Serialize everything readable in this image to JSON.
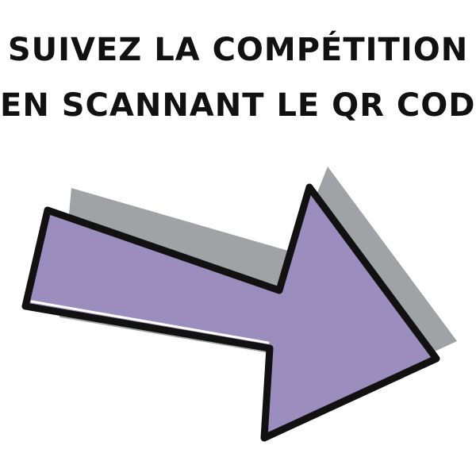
{
  "headline": {
    "line1": "SUIVEZ LA COMPÉTITION",
    "line2": "EN SCANNANT LE QR CODE"
  },
  "arrow": {
    "icon": "arrow-right-icon",
    "fill_color": "#9b8dbe",
    "shadow_color": "#a1a2a6",
    "outline_color": "#111111"
  }
}
